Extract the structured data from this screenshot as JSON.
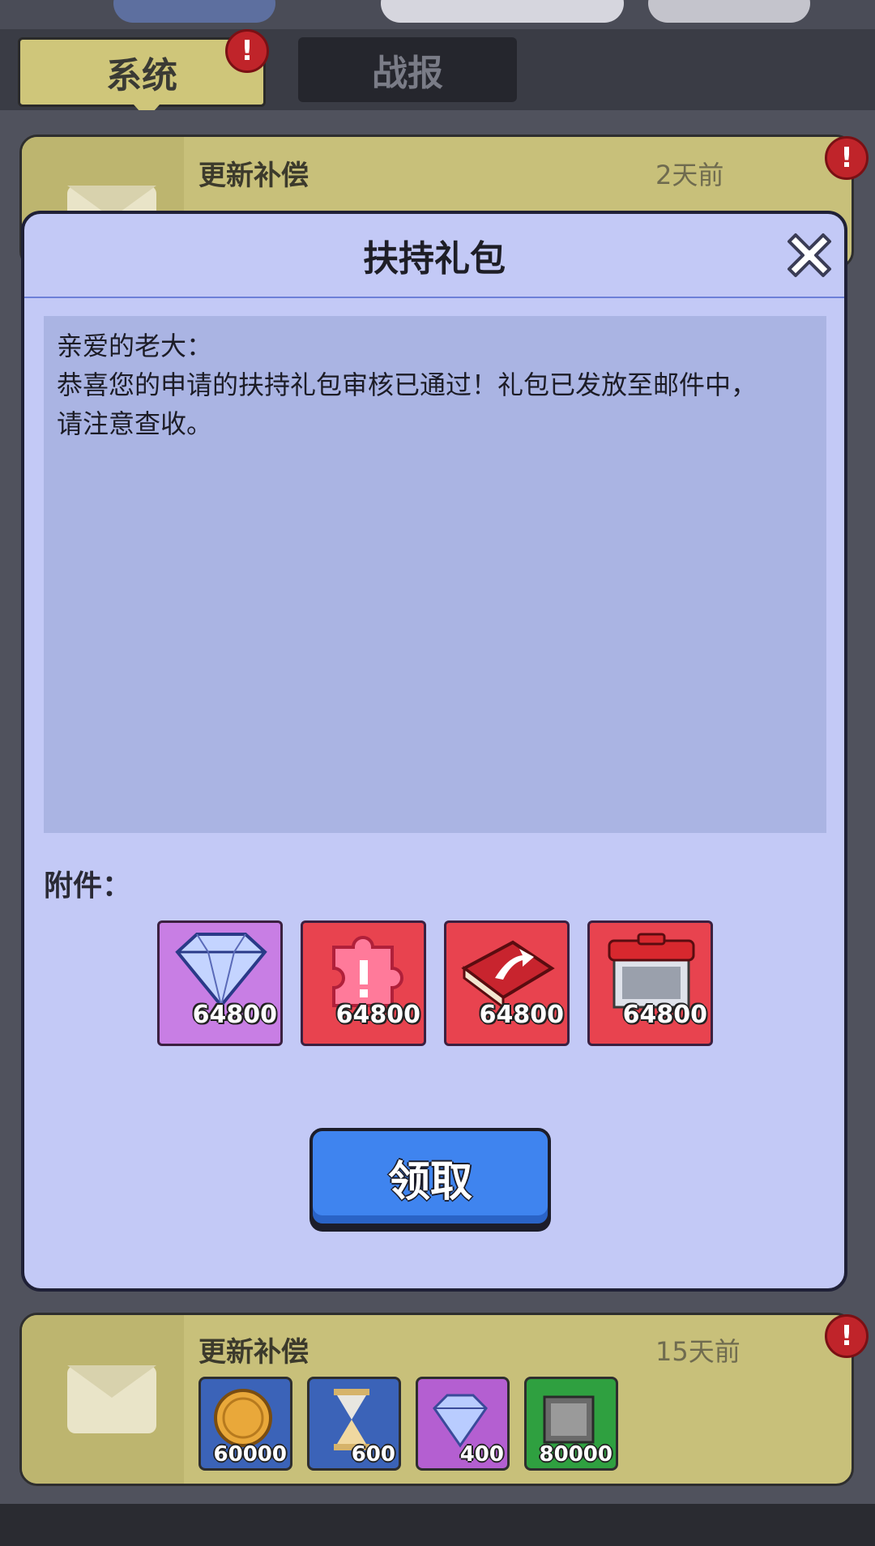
{
  "tabs": {
    "system": "系统",
    "report": "战报",
    "system_alert": "!"
  },
  "mails": [
    {
      "title": "更新补偿",
      "time": "2天前",
      "alert": "!"
    },
    {
      "title": "更新补偿",
      "time": "15天前",
      "alert": "!",
      "items": [
        {
          "icon": "coin-icon",
          "qty": "60000",
          "color": "#3b63b8"
        },
        {
          "icon": "hourglass-icon",
          "qty": "600",
          "color": "#3b63b8"
        },
        {
          "icon": "diamond-icon",
          "qty": "400",
          "color": "#b45fd1"
        },
        {
          "icon": "crate-icon",
          "qty": "80000",
          "color": "#2fa040"
        }
      ]
    }
  ],
  "modal": {
    "title": "扶持礼包",
    "message_lines": [
      "亲爱的老大：",
      "恭喜您的申请的扶持礼包审核已通过！礼包已发放至邮件中，",
      "请注意查收。"
    ],
    "attachments_label": "附件：",
    "attachments": [
      {
        "icon": "diamond-icon",
        "qty": "64800",
        "color": "#c87ee4"
      },
      {
        "icon": "puzzle-piece-icon",
        "qty": "64800",
        "color": "#e8434f"
      },
      {
        "icon": "upgrade-book-icon",
        "qty": "64800",
        "color": "#e8434f"
      },
      {
        "icon": "parts-box-icon",
        "qty": "64800",
        "color": "#e8434f"
      }
    ],
    "claim_label": "领取"
  }
}
